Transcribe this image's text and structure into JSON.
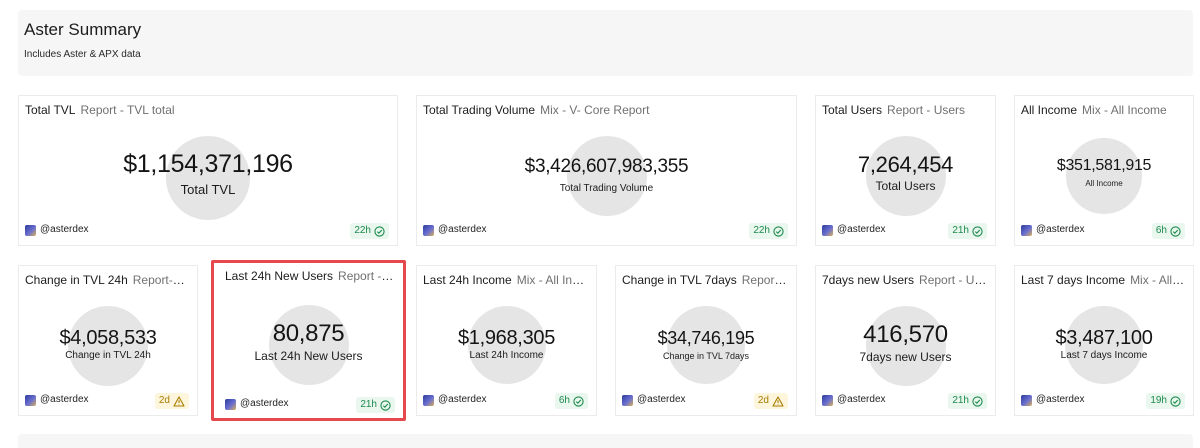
{
  "header": {
    "title": "Aster Summary",
    "subtitle": "Includes Aster & APX data"
  },
  "cards": [
    {
      "title": "Total TVL",
      "subtitle": "Report - TVL total",
      "value": "$1,154,371,196",
      "label": "Total TVL",
      "owner": "@asterdex",
      "freshness": "22h",
      "status": "ok"
    },
    {
      "title": "Total Trading Volume",
      "subtitle": "Mix - V- Core Report",
      "value": "$3,426,607,983,355",
      "label": "Total Trading Volume",
      "owner": "@asterdex",
      "freshness": "22h",
      "status": "ok"
    },
    {
      "title": "Total Users",
      "subtitle": "Report - Users",
      "value": "7,264,454",
      "label": "Total Users",
      "owner": "@asterdex",
      "freshness": "21h",
      "status": "ok"
    },
    {
      "title": "All Income",
      "subtitle": "Mix - All Income",
      "value": "$351,581,915",
      "label": "All Income",
      "owner": "@asterdex",
      "freshness": "6h",
      "status": "ok"
    },
    {
      "title": "Change in TVL 24h",
      "subtitle": "Report-chan...",
      "value": "$4,058,533",
      "label": "Change in TVL 24h",
      "owner": "@asterdex",
      "freshness": "2d",
      "status": "warn"
    },
    {
      "title": "Last 24h New Users",
      "subtitle": "Report - Us...",
      "value": "80,875",
      "label": "Last 24h New Users",
      "owner": "@asterdex",
      "freshness": "21h",
      "status": "ok"
    },
    {
      "title": "Last 24h Income",
      "subtitle": "Mix - All Income",
      "value": "$1,968,305",
      "label": "Last 24h Income",
      "owner": "@asterdex",
      "freshness": "6h",
      "status": "ok"
    },
    {
      "title": "Change in TVL 7days",
      "subtitle": "Report-ch...",
      "value": "$34,746,195",
      "label": "Change in TVL 7days",
      "owner": "@asterdex",
      "freshness": "2d",
      "status": "warn"
    },
    {
      "title": "7days new Users",
      "subtitle": "Report - Users",
      "value": "416,570",
      "label": "7days new Users",
      "owner": "@asterdex",
      "freshness": "21h",
      "status": "ok"
    },
    {
      "title": "Last 7 days Income",
      "subtitle": "Mix - All Inc...",
      "value": "$3,487,100",
      "label": "Last 7 days Income",
      "owner": "@asterdex",
      "freshness": "19h",
      "status": "ok"
    }
  ],
  "icons": {
    "ok": "check-circle-icon",
    "warn": "warning-triangle-icon"
  },
  "colors": {
    "selection_outline": "#e5484d",
    "ok_badge_bg": "#e9f7ef",
    "ok_badge_text": "#1d8a4c",
    "warn_badge_bg": "#fdf6dc",
    "warn_badge_text": "#a67c00",
    "disc": "#e5e5e5"
  }
}
